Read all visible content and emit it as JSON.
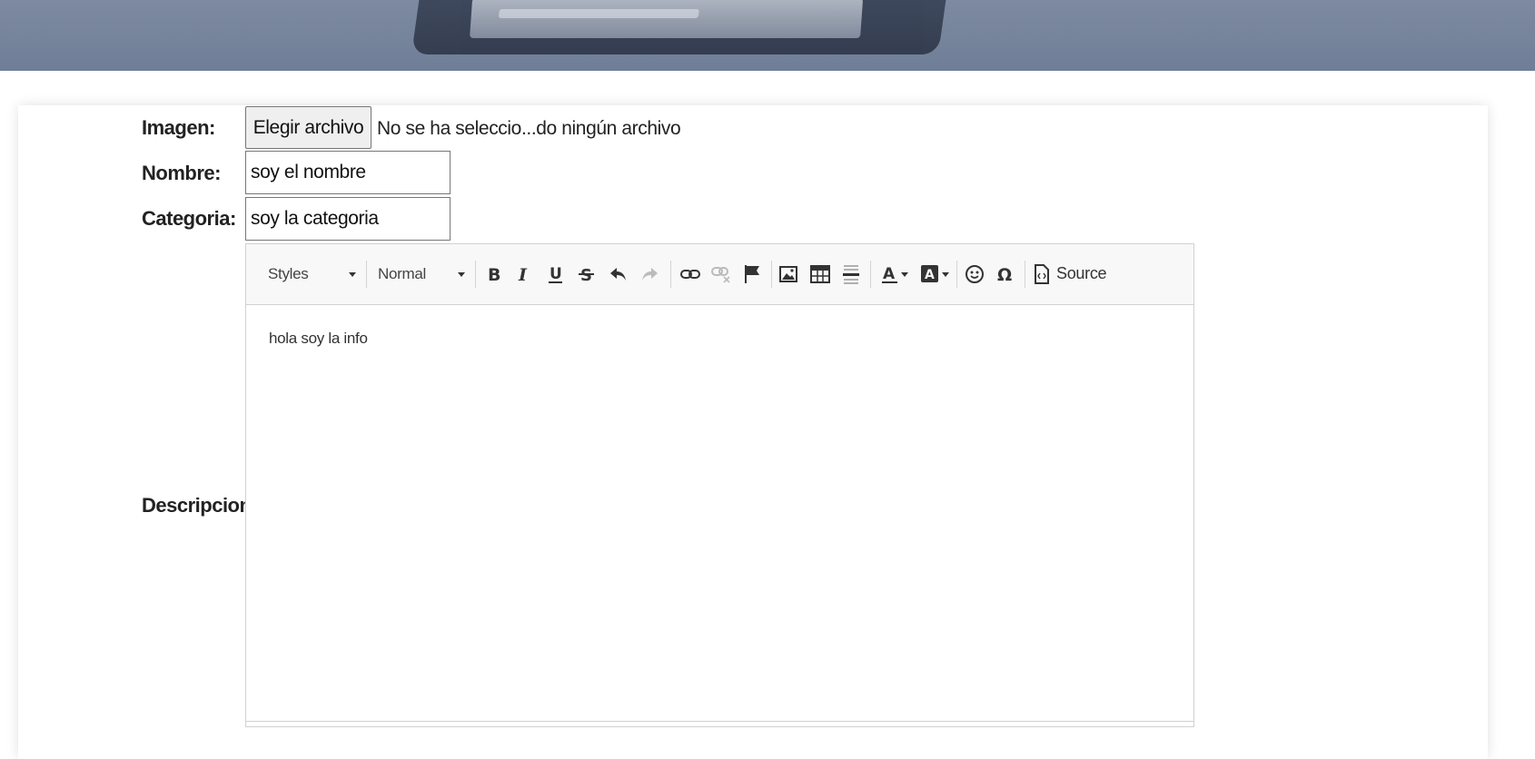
{
  "form": {
    "imagen_label": "Imagen:",
    "nombre_label": "Nombre:",
    "categoria_label": "Categoria:",
    "descripcion_label": "Descripcion:",
    "file_button_label": "Elegir archivo",
    "file_status": "No se ha seleccio...do ningún archivo",
    "nombre_value": "soy el nombre",
    "categoria_value": "soy la categoria"
  },
  "editor": {
    "styles_label": "Styles",
    "format_label": "Normal",
    "source_label": "Source",
    "content": "hola soy la info",
    "toolbar_icons": [
      "bold-icon",
      "italic-icon",
      "underline-icon",
      "strikethrough-icon",
      "undo-icon",
      "redo-icon",
      "link-icon",
      "unlink-icon",
      "anchor-flag-icon",
      "image-icon",
      "table-icon",
      "horizontal-line-icon",
      "text-color-icon",
      "background-color-icon",
      "smiley-icon",
      "special-char-omega-icon",
      "source-icon"
    ]
  },
  "colors": {
    "banner": "#7d8aa1",
    "toolbar_bg": "#f8f8f8",
    "border": "#767676"
  }
}
